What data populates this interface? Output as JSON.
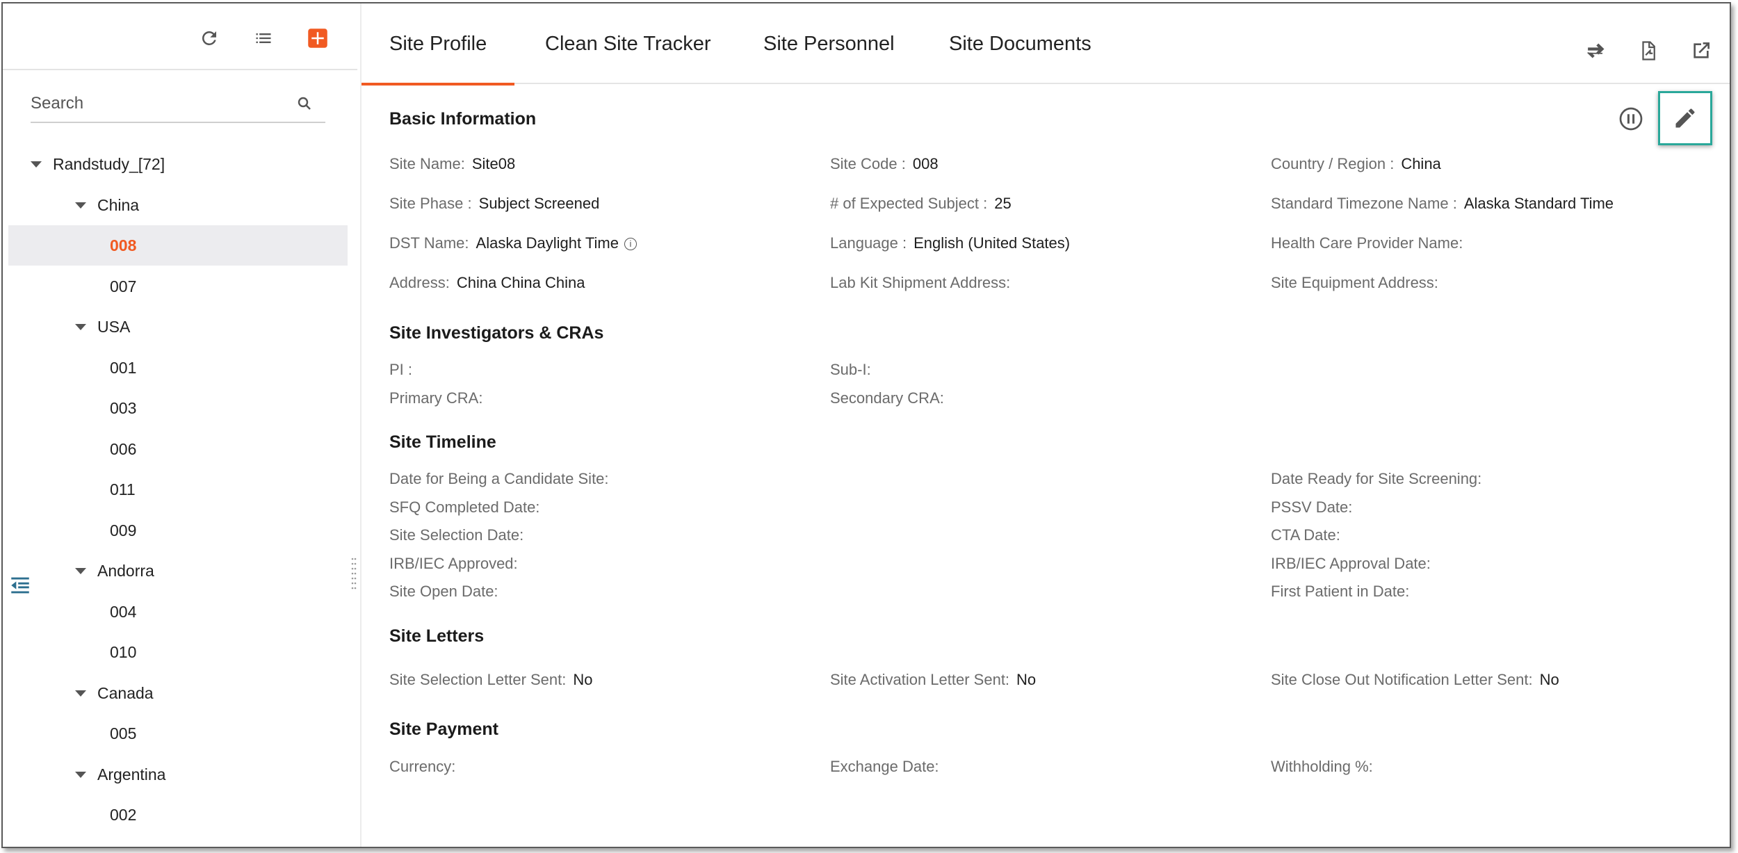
{
  "sidebar": {
    "search": {
      "placeholder": "Search"
    },
    "tree": {
      "root": "Randstudy_[72]",
      "groups": [
        {
          "label": "China",
          "items": [
            "008",
            "007"
          ]
        },
        {
          "label": "USA",
          "items": [
            "001",
            "003",
            "006",
            "011",
            "009"
          ]
        },
        {
          "label": "Andorra",
          "items": [
            "004",
            "010"
          ]
        },
        {
          "label": "Canada",
          "items": [
            "005"
          ]
        },
        {
          "label": "Argentina",
          "items": [
            "002"
          ]
        }
      ],
      "selected": "008"
    },
    "icons": {
      "refresh": "refresh-icon",
      "list": "list-icon",
      "add": "add-icon",
      "collapse": "collapse-sidebar-icon"
    },
    "add_color": "#f15a22"
  },
  "tabs": [
    "Site Profile",
    "Clean Site Tracker",
    "Site Personnel",
    "Site Documents"
  ],
  "active_tab": "Site Profile",
  "accent": "#f15a22",
  "highlight": "#2aa89a",
  "sections": {
    "basic": {
      "title": "Basic Information",
      "site_name": {
        "label": "Site Name:",
        "value": "Site08"
      },
      "site_code": {
        "label": "Site Code :",
        "value": "008"
      },
      "country": {
        "label": "Country / Region :",
        "value": "China"
      },
      "site_phase": {
        "label": "Site Phase :",
        "value": "Subject Screened"
      },
      "expected_subject": {
        "label": "# of Expected Subject :",
        "value": "25"
      },
      "std_timezone": {
        "label": "Standard Timezone Name :",
        "value": "Alaska Standard Time"
      },
      "dst_name": {
        "label": "DST Name:",
        "value": "Alaska Daylight Time"
      },
      "language": {
        "label": "Language :",
        "value": "English (United States)"
      },
      "hcp_name": {
        "label": "Health Care Provider Name:",
        "value": ""
      },
      "address": {
        "label": "Address:",
        "value": "China China China"
      },
      "lab_kit": {
        "label": "Lab Kit Shipment Address:",
        "value": ""
      },
      "equipment": {
        "label": "Site Equipment Address:",
        "value": ""
      }
    },
    "investigators": {
      "title": "Site Investigators & CRAs",
      "pi": "PI :",
      "sub_i": "Sub-I:",
      "primary_cra": "Primary CRA:",
      "secondary_cra": "Secondary CRA:"
    },
    "timeline": {
      "title": "Site Timeline",
      "left": [
        "Date for Being a Candidate Site:",
        "SFQ Completed Date:",
        "Site Selection Date:",
        "IRB/IEC Approved:",
        "Site Open Date:"
      ],
      "right": [
        "Date Ready for Site Screening:",
        "PSSV Date:",
        "CTA Date:",
        "IRB/IEC Approval Date:",
        "First Patient in Date:"
      ]
    },
    "letters": {
      "title": "Site Letters",
      "selection": {
        "label": "Site Selection Letter Sent:",
        "value": "No"
      },
      "activation": {
        "label": "Site Activation Letter Sent:",
        "value": "No"
      },
      "close_out": {
        "label": "Site Close Out Notification Letter Sent:",
        "value": "No"
      }
    },
    "payment": {
      "title": "Site Payment",
      "currency": "Currency:",
      "exchange_date": "Exchange Date:",
      "withholding": "Withholding %:"
    }
  }
}
